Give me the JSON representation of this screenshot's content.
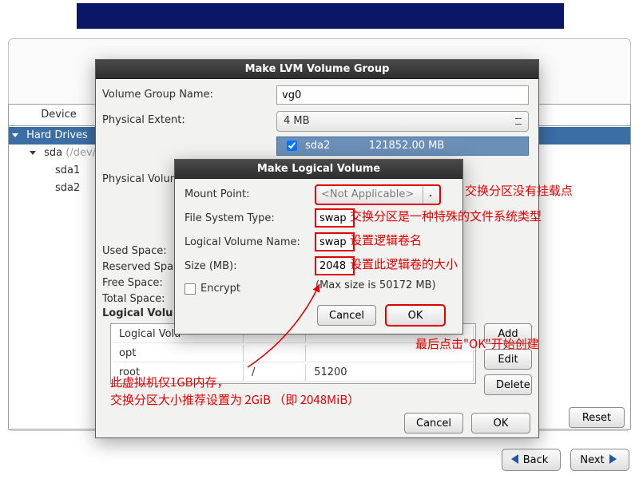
{
  "tree": {
    "header_device": "Device",
    "hard_drives": "Hard Drives",
    "sda": "sda",
    "sda_hint": "(/dev/sda",
    "sda1": "sda1",
    "sda2": "sda2"
  },
  "dlg1": {
    "title": "Make LVM Volume Group",
    "vg_label": "Volume Group Name:",
    "vg_value": "vg0",
    "pe_label": "Physical Extent:",
    "pe_value": "4 MB",
    "phys_dev": "sda2",
    "phys_size": "121852.00 MB",
    "phys_heading": "Physical Volum",
    "used": "Used Space:",
    "reserved": "Reserved Spac",
    "free": "Free Space:",
    "total": "Total Space:",
    "lv_heading": "Logical Volu",
    "lv_col": "Logical Volu",
    "lv_opt": "opt",
    "lv_root": "root",
    "lv_root_mp": "/",
    "lv_root_size": "51200",
    "add": "Add",
    "edit": "Edit",
    "delete": "Delete",
    "cancel": "Cancel",
    "ok": "OK"
  },
  "dlg2": {
    "title": "Make Logical Volume",
    "mp_label": "Mount Point:",
    "mp_value": "<Not Applicable>",
    "fs_label": "File System Type:",
    "fs_value": "swap",
    "lvn_label": "Logical Volume Name:",
    "lvn_value": "swap",
    "size_label": "Size (MB):",
    "size_value": "2048",
    "encrypt": "Encrypt",
    "max": "(Max size is 50172 MB)",
    "cancel": "Cancel",
    "ok": "OK"
  },
  "annot": {
    "a1": "交换分区没有挂载点",
    "a2": "交换分区是一种特殊的文件系统类型",
    "a3": "设置逻辑卷名",
    "a4": "设置此逻辑卷的大小",
    "a5": "最后点击\"OK\"开始创建",
    "a6a": "此虚拟机仅1GB内存，",
    "a6b": "交换分区大小推荐设置为 2GiB （即 2048MiB）"
  },
  "footer": {
    "reset": "Reset",
    "back": "Back",
    "next": "Next"
  }
}
